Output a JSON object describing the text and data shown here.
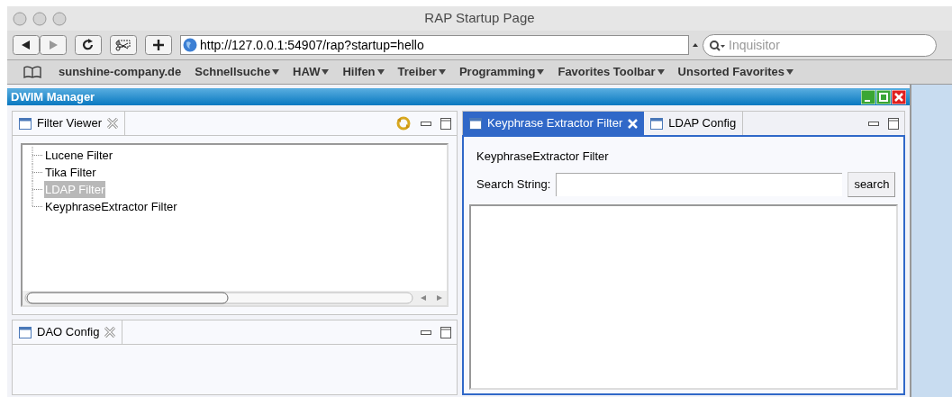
{
  "window": {
    "title": "RAP Startup Page"
  },
  "toolbar": {
    "url": "http://127.0.0.1:54907/rap?startup=hello",
    "search": {
      "placeholder": "Inquisitor"
    }
  },
  "bookmarks": [
    {
      "label": "sunshine-company.de",
      "menu": false
    },
    {
      "label": "Schnellsuche",
      "menu": true
    },
    {
      "label": "HAW",
      "menu": true
    },
    {
      "label": "Hilfen",
      "menu": true
    },
    {
      "label": "Treiber",
      "menu": true
    },
    {
      "label": "Programming",
      "menu": true
    },
    {
      "label": "Favorites Toolbar",
      "menu": true
    },
    {
      "label": "Unsorted Favorites",
      "menu": true
    }
  ],
  "app": {
    "title": "DWIM Manager",
    "filter_viewer": {
      "tab": "Filter Viewer",
      "tree": [
        {
          "label": "Lucene Filter",
          "selected": false
        },
        {
          "label": "Tika Filter",
          "selected": false
        },
        {
          "label": "LDAP Filter",
          "selected": true
        },
        {
          "label": "KeyphraseExtractor Filter",
          "selected": false
        }
      ]
    },
    "dao_config": {
      "tab": "DAO Config"
    },
    "editor": {
      "tabs": [
        {
          "label": "Keyphrase Extractor Filter",
          "selected": true
        },
        {
          "label": "LDAP Config",
          "selected": false
        }
      ],
      "heading": "KeyphraseExtractor Filter",
      "search_label": "Search String:",
      "button": "search"
    }
  }
}
